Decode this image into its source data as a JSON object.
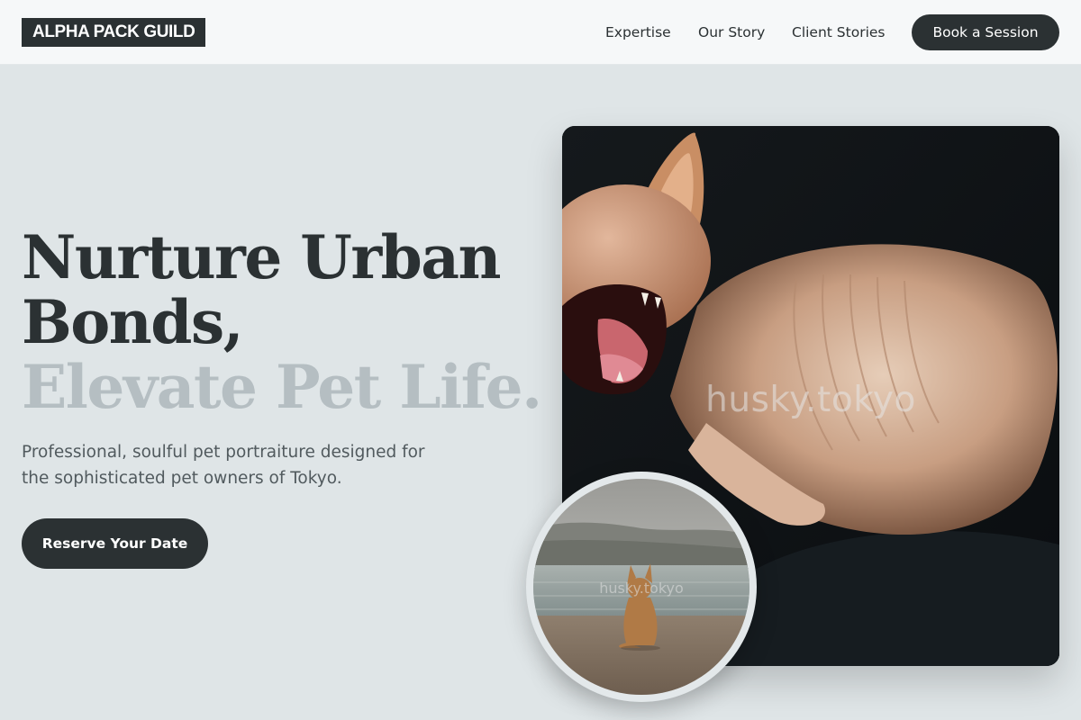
{
  "header": {
    "logo": "ALPHA PACK GUILD",
    "nav": [
      "Expertise",
      "Our Story",
      "Client Stories"
    ],
    "cta": "Book a Session"
  },
  "hero": {
    "title_lines": [
      "Nurture Urban",
      "Bonds,",
      "Elevate Pet Life."
    ],
    "subtitle": "Professional, soulful pet portraiture designed for the sophisticated pet owners of Tokyo.",
    "cta": "Reserve Your Date"
  },
  "media": {
    "main_watermark": "husky.tokyo",
    "circle_watermark": "husky.tokyo"
  },
  "colors": {
    "background": "#dfe5e7",
    "header": "#f6f8f9",
    "dark": "#2b3133",
    "muted_heading": "#b5bec2",
    "body_text": "#515a5e"
  }
}
